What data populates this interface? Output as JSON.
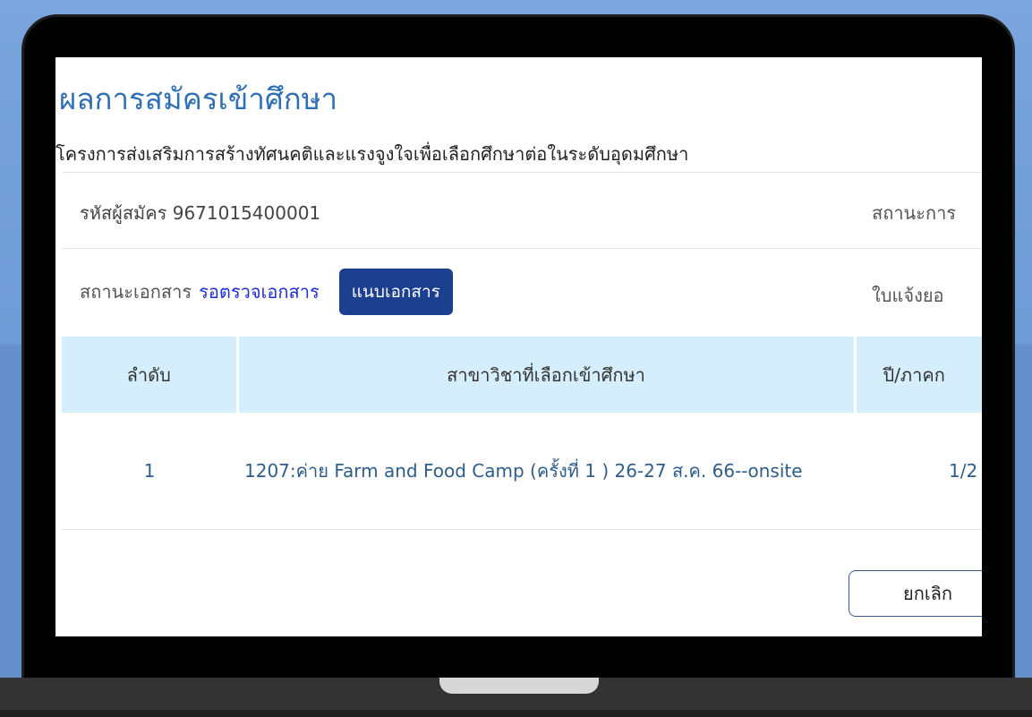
{
  "page": {
    "title": "ผลการสมัครเข้าศึกษา",
    "project_name": "โครงการส่งเสริมการสร้างทัศนคติและแรงจูงใจเพื่อเลือกศึกษาต่อในระดับอุดมศึกษา"
  },
  "applicant": {
    "id_label": "รหัสผู้สมัคร",
    "id_value": "9671015400001",
    "status_label_partial": "สถานะการ"
  },
  "documents": {
    "status_label": "สถานะเอกสาร",
    "status_value": "รอตรวจเอกสาร",
    "attach_button": "แนบเอกสาร",
    "invoice_label_partial": "ใบแจ้งยอ"
  },
  "table": {
    "headers": [
      "ลำดับ",
      "สาขาวิชาที่เลือกเข้าศึกษา",
      "ปี/ภาคก"
    ],
    "rows": [
      {
        "order": "1",
        "course": "1207:ค่าย Farm and Food Camp (ครั้งที่ 1 ) 26-27 ส.ค. 66--onsite",
        "term": "1/2"
      }
    ]
  },
  "actions": {
    "cancel_button": "ยกเลิก"
  },
  "colors": {
    "title": "#2f6fb5",
    "link_status": "#1f2fd6",
    "button_primary": "#1d3f8f",
    "table_header_bg": "#d4eefb",
    "background": "#6f9bd6"
  }
}
